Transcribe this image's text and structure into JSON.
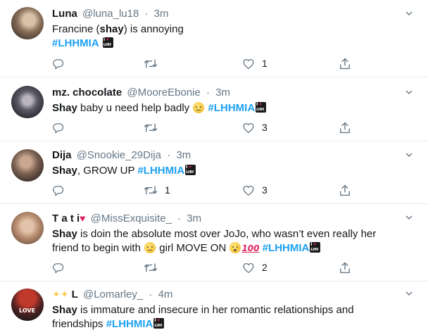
{
  "tweets": [
    {
      "name": "Luna",
      "handle": "@luna_lu18",
      "sep": "·",
      "time": "3m",
      "text_a": "Francine (",
      "text_bold": "shay",
      "text_b": ") is annoying",
      "hashtag": "#LHHMIA",
      "retweets": "",
      "likes": "1",
      "avatar_color": "#8a6f5a"
    },
    {
      "name": "mz. chocolate",
      "handle": "@MooreEbonie",
      "sep": "·",
      "time": "3m",
      "text_bold": "Shay",
      "text_b": " baby u need help badly",
      "hashtag": "#LHHMIA",
      "retweets": "",
      "likes": "3",
      "avatar_color": "#3a3a44"
    },
    {
      "name": "Dija",
      "handle": "@Snookie_29Dija",
      "sep": "·",
      "time": "3m",
      "text_bold": "Shay",
      "text_b": ", GROW UP",
      "hashtag": "#LHHMIA",
      "retweets": "1",
      "likes": "3",
      "avatar_color": "#5b4a3f"
    },
    {
      "name": "T a t i",
      "handle": "@MissExquisite_",
      "sep": "·",
      "time": "3m",
      "text_bold": "Shay",
      "text_b": " is doin the absolute most over JoJo, who wasn’t even really her friend to begin with",
      "text_c": " girl MOVE ON",
      "hashtag": "#LHHMIA",
      "retweets": "",
      "likes": "2",
      "avatar_color": "#c9a48a"
    },
    {
      "name": "L",
      "handle": "@Lomarley_",
      "sep": "·",
      "time": "4m",
      "text_bold": "Shay",
      "text_b": " is immature and insecure in her romantic relationships and friendships",
      "hashtag": "#LHHMIA",
      "avatar_badge": "LOVE",
      "avatar_color": "#6b2b2b"
    }
  ],
  "lhh_badge": {
    "line1": "I",
    "line2": "LHH"
  },
  "hundred": "100",
  "icons": [
    "reply-icon",
    "retweet-icon",
    "like-icon",
    "share-icon",
    "chevron-down-icon"
  ],
  "colors": {
    "hashtag": "#1da1f2",
    "muted": "#657786",
    "divider": "#e6ecf0"
  }
}
